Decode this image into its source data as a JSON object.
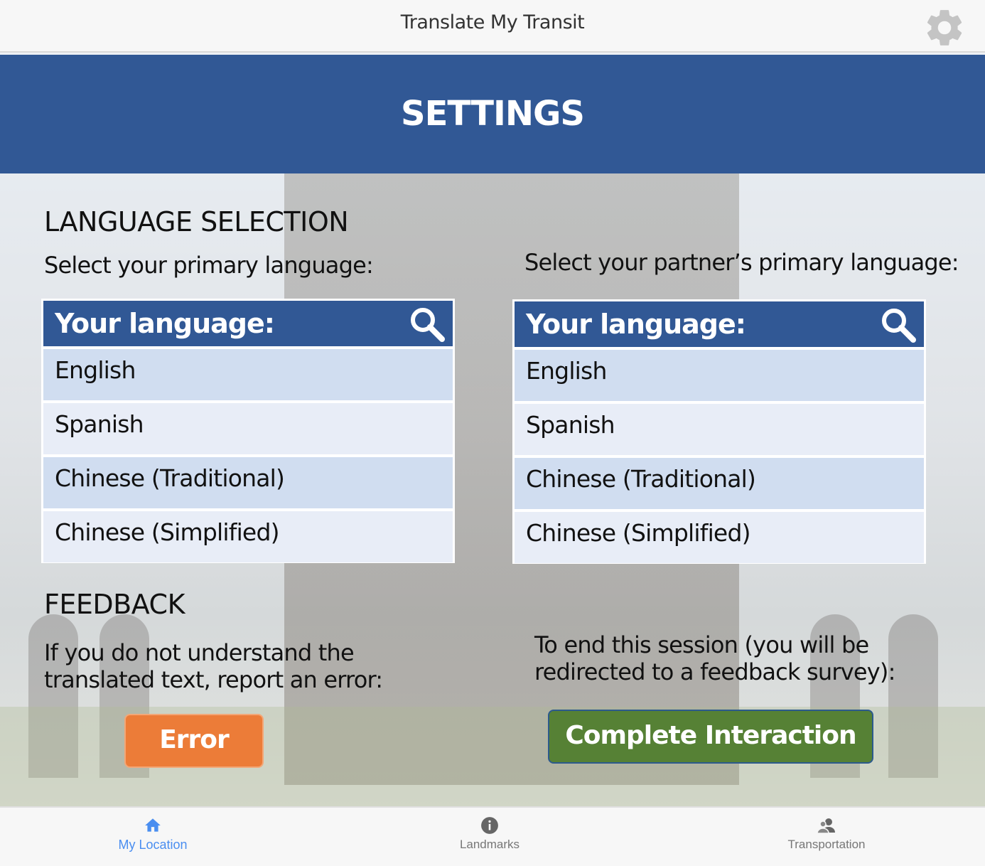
{
  "app": {
    "title": "Translate My Transit"
  },
  "header": {
    "title": "SETTINGS"
  },
  "language_section": {
    "heading": "LANGUAGE SELECTION",
    "primary_prompt": "Select your primary language:",
    "partner_prompt": "Select your partner’s primary language:",
    "primary_panel": {
      "header_label": "Your language:",
      "items": [
        "English",
        "Spanish",
        "Chinese (Traditional)",
        "Chinese (Simplified)"
      ]
    },
    "partner_panel": {
      "header_label": "Your language:",
      "items": [
        "English",
        "Spanish",
        "Chinese (Traditional)",
        "Chinese (Simplified)"
      ]
    }
  },
  "feedback_section": {
    "heading": "FEEDBACK",
    "error_prompt_line1": "If you do not understand the",
    "error_prompt_line2": "translated text, report an error:",
    "error_button": "Error",
    "end_prompt_line1": "To end this session (you will be",
    "end_prompt_line2": "redirected to a feedback survey):",
    "complete_button": "Complete Interaction"
  },
  "tabbar": {
    "tabs": [
      {
        "label": "My Location",
        "icon": "home-icon",
        "active": true
      },
      {
        "label": "Landmarks",
        "icon": "info-icon",
        "active": false
      },
      {
        "label": "Transportation",
        "icon": "people-icon",
        "active": false
      }
    ]
  },
  "colors": {
    "primary_blue": "#315895",
    "error_orange": "#ec7c38",
    "complete_green": "#568135",
    "active_tab": "#4a8ef0"
  }
}
